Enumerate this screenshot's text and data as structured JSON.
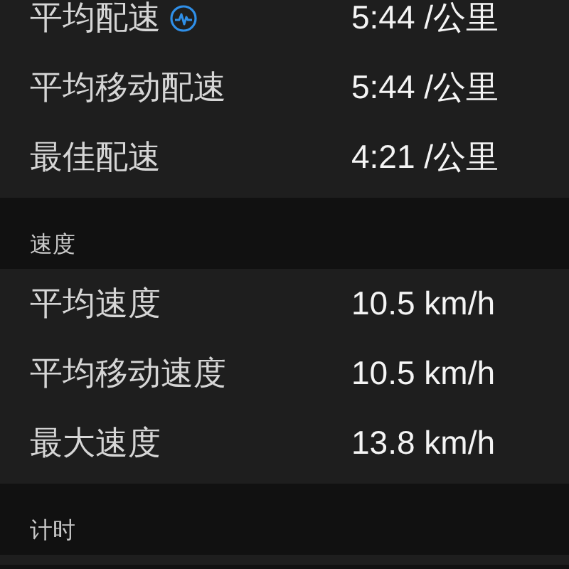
{
  "sections": [
    {
      "rows": [
        {
          "label": "平均配速",
          "value": "5:44 /公里",
          "heart_rate_icon": true
        },
        {
          "label": "平均移动配速",
          "value": "5:44 /公里",
          "heart_rate_icon": false
        },
        {
          "label": "最佳配速",
          "value": "4:21 /公里",
          "heart_rate_icon": false
        }
      ]
    },
    {
      "header": "速度",
      "rows": [
        {
          "label": "平均速度",
          "value": "10.5 km/h",
          "heart_rate_icon": false
        },
        {
          "label": "平均移动速度",
          "value": "10.5 km/h",
          "heart_rate_icon": false
        },
        {
          "label": "最大速度",
          "value": "13.8 km/h",
          "heart_rate_icon": false
        }
      ]
    },
    {
      "header": "计时"
    }
  ]
}
